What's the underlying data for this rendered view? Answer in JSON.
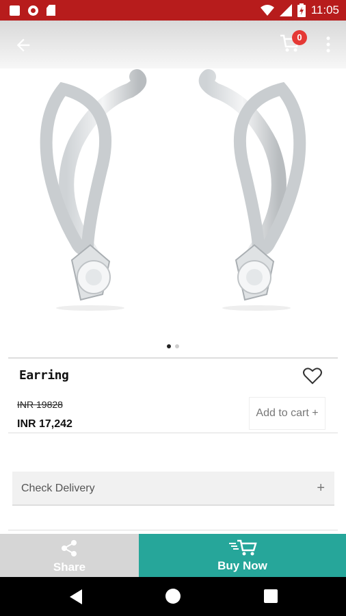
{
  "status_bar": {
    "time": "11:05"
  },
  "toolbar": {
    "cart_count": "0",
    "icons": [
      "back-arrow-icon",
      "cart-icon",
      "more-vert-icon"
    ]
  },
  "product": {
    "title": "Earring",
    "old_price": "INR 19828",
    "price": "INR 17,242",
    "add_to_cart": "Add to cart +",
    "image_count": 2,
    "active_image": 1
  },
  "delivery": {
    "label": "Check Delivery",
    "expand": "+"
  },
  "bottom_bar": {
    "share": "Share",
    "buy_now": "Buy Now"
  },
  "colors": {
    "status_bar": "#b71c1c",
    "accent": "#26a69a",
    "badge": "#e53935"
  }
}
